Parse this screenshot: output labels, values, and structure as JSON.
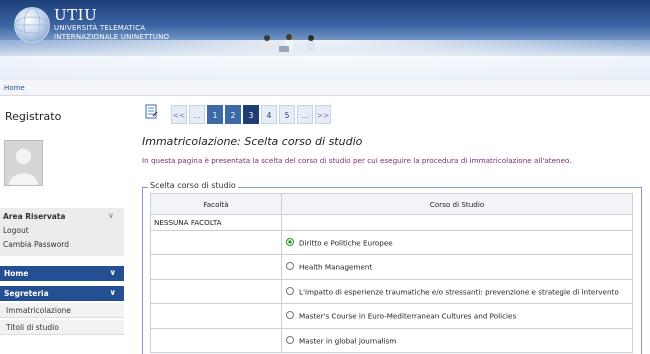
{
  "header": {
    "brand_big": "UTIU",
    "brand_line1": "UNIVERSITÀ TELEMATICA",
    "brand_line2": "INTERNAZIONALE UNINETTUNO"
  },
  "breadcrumb": {
    "home": "Home"
  },
  "sidebar": {
    "title": "Registrato",
    "area": {
      "title": "Area Riservata",
      "items": [
        "Logout",
        "Cambia Password"
      ]
    },
    "nav": {
      "home": "Home",
      "segreteria": "Segreteria",
      "sub": [
        "Immatricolazione",
        "Titoli di studio"
      ]
    }
  },
  "pager": {
    "first": "<<",
    "ellipsis_left": "...",
    "pages": [
      "1",
      "2",
      "3",
      "4",
      "5"
    ],
    "ellipsis_right": "...",
    "next": ">>",
    "current": "3"
  },
  "main": {
    "title": "Immatricolazione: Scelta corso di studio",
    "intro": "In questa pagina è presentata la scelta del corso di studio per cui eseguire la procedura di immatricolazione all'ateneo.",
    "legend": "Scelta corso di studio",
    "table": {
      "headers": [
        "Facoltà",
        "Corso di Studio"
      ],
      "faculty": "NESSUNA FACOLTA",
      "courses": [
        {
          "label": "Diritto e Politiche Europee",
          "checked": true
        },
        {
          "label": "Health Management",
          "checked": false
        },
        {
          "label": "L'impatto di esperienze traumatiche e/o stressanti: prevenzione e strategie di intervento",
          "checked": false
        },
        {
          "label": "Master's Course in Euro-Mediterranean Cultures and Policies",
          "checked": false
        },
        {
          "label": "Master in global journalism",
          "checked": false
        }
      ]
    }
  },
  "colors": {
    "nav_blue": "#245093",
    "pager_selected": "#1f3c74",
    "intro_text": "#7a2f6e"
  }
}
